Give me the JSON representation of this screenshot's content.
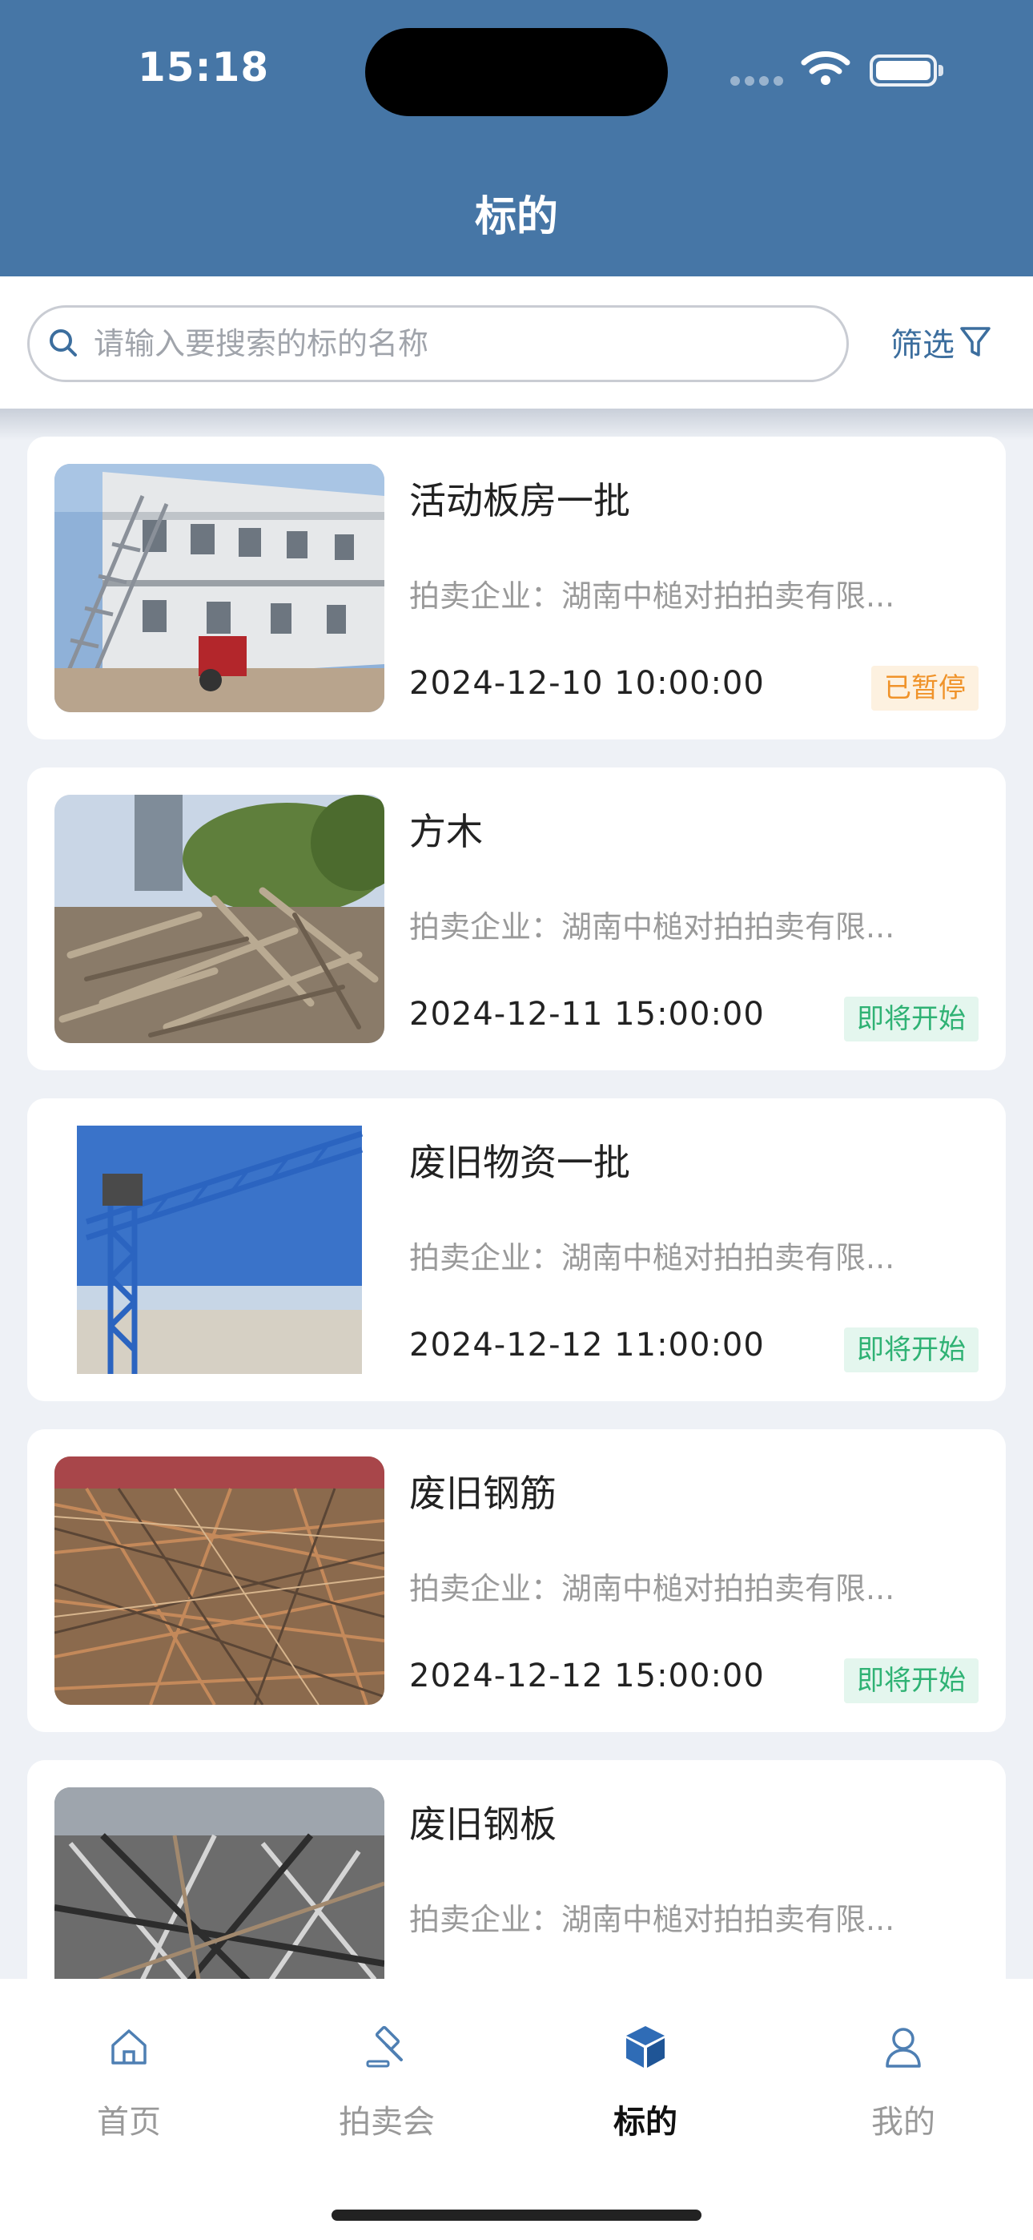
{
  "status_bar": {
    "time": "15:18"
  },
  "header": {
    "title": "标的"
  },
  "search": {
    "placeholder": "请输入要搜索的标的名称",
    "value": ""
  },
  "filter": {
    "label": "筛选",
    "icon": "filter-icon"
  },
  "items": [
    {
      "title": "活动板房一批",
      "company": "拍卖企业：湖南中槌对拍拍卖有限...",
      "date": "2024-12-10 10:00:00",
      "status": "已暂停",
      "status_type": "paused",
      "image": "prefab-house-photo"
    },
    {
      "title": "方木",
      "company": "拍卖企业：湖南中槌对拍拍卖有限...",
      "date": "2024-12-11 15:00:00",
      "status": "即将开始",
      "status_type": "upcoming",
      "image": "timber-pile-photo"
    },
    {
      "title": "废旧物资一批",
      "company": "拍卖企业：湖南中槌对拍拍卖有限...",
      "date": "2024-12-12 11:00:00",
      "status": "即将开始",
      "status_type": "upcoming",
      "image": "tower-crane-photo"
    },
    {
      "title": "废旧钢筋",
      "company": "拍卖企业：湖南中槌对拍拍卖有限...",
      "date": "2024-12-12 15:00:00",
      "status": "即将开始",
      "status_type": "upcoming",
      "image": "rebar-pile-photo"
    },
    {
      "title": "废旧钢板",
      "company": "拍卖企业：湖南中槌对拍拍卖有限...",
      "date": "",
      "status": "",
      "status_type": "",
      "image": "steel-scrap-photo"
    }
  ],
  "tabs": [
    {
      "label": "首页",
      "icon": "home-icon",
      "active": false
    },
    {
      "label": "拍卖会",
      "icon": "gavel-icon",
      "active": false
    },
    {
      "label": "标的",
      "icon": "cube-icon",
      "active": true
    },
    {
      "label": "我的",
      "icon": "user-icon",
      "active": false
    }
  ],
  "colors": {
    "header": "#4676a6",
    "accent": "#3c6e9e",
    "paused_text": "#f0932a",
    "upcoming_text": "#2fb274"
  }
}
